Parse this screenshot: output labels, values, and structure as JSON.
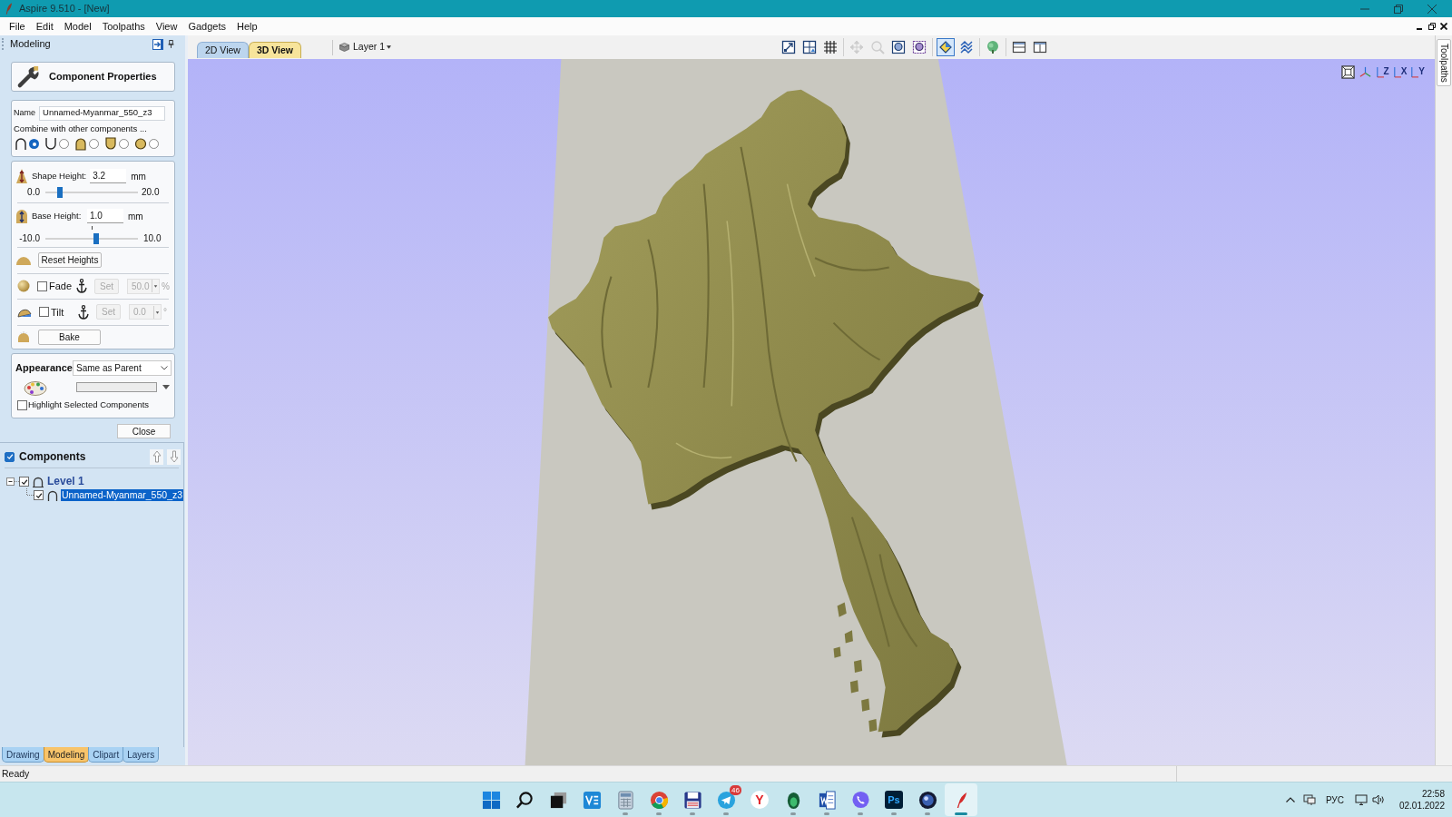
{
  "window": {
    "title": "Aspire 9.510 - [New]"
  },
  "menu": [
    "File",
    "Edit",
    "Model",
    "Toolpaths",
    "View",
    "Gadgets",
    "Help"
  ],
  "left_panel": {
    "title": "Modeling",
    "properties_header": "Component Properties",
    "name": {
      "label": "Name",
      "value": "Unnamed-Myanmar_550_z3"
    },
    "combine": {
      "label": "Combine with other components ...",
      "modes": [
        {
          "kind": "add",
          "selected": true
        },
        {
          "kind": "subtract",
          "selected": false
        },
        {
          "kind": "merge",
          "selected": false
        },
        {
          "kind": "low",
          "selected": false
        },
        {
          "kind": "multiply",
          "selected": false
        }
      ]
    },
    "shape_height": {
      "label": "Shape Height:",
      "value": "3.2",
      "unit": "mm",
      "min": "0.0",
      "max": "20.0",
      "level": 0.16
    },
    "base_height": {
      "label": "Base Height:",
      "value": "1.0",
      "unit": "mm",
      "min": "-10.0",
      "max": "10.0",
      "level": 0.55
    },
    "reset_button": "Reset Heights",
    "fade": {
      "label": "Fade",
      "checked": false,
      "disabled": true,
      "button": "Set",
      "value": "50.0",
      "unit": "%"
    },
    "tilt": {
      "label": "Tilt",
      "checked": false,
      "disabled": true,
      "button": "Set",
      "value": "0.0",
      "unit": "°"
    },
    "bake_button": "Bake",
    "appearance": {
      "label": "Appearance",
      "value": "Same as Parent"
    },
    "highlight": {
      "label": "Highlight Selected Components",
      "checked": false
    },
    "close_button": "Close",
    "components": {
      "title": "Components",
      "checked": true,
      "tree": [
        {
          "label": "Level 1",
          "checked": true,
          "expanded": true,
          "selected": false,
          "children": [
            {
              "label": "Unnamed-Myanmar_550_z3",
              "checked": true,
              "selected": true
            }
          ]
        }
      ]
    },
    "tabs": [
      {
        "label": "Drawing",
        "selected": false
      },
      {
        "label": "Modeling",
        "selected": true
      },
      {
        "label": "Clipart",
        "selected": false
      },
      {
        "label": "Layers",
        "selected": false
      }
    ]
  },
  "view": {
    "tabs": [
      {
        "label": "2D View",
        "selected": false
      },
      {
        "label": "3D View",
        "selected": true
      }
    ],
    "layer": "Layer 1",
    "toolbar": [
      [
        {
          "kind": "fit",
          "on": false,
          "disabled": false
        },
        {
          "kind": "split",
          "on": false,
          "disabled": false
        },
        {
          "kind": "grid",
          "on": false,
          "disabled": false
        }
      ],
      [
        {
          "kind": "pan",
          "on": false,
          "disabled": true
        },
        {
          "kind": "zoom",
          "on": false,
          "disabled": true
        },
        {
          "kind": "zoom-box",
          "on": false,
          "disabled": false
        },
        {
          "kind": "zoom-select",
          "on": false,
          "disabled": false
        }
      ],
      [
        {
          "kind": "shade",
          "on": true,
          "disabled": false
        },
        {
          "kind": "wave",
          "on": false,
          "disabled": false
        }
      ],
      [
        {
          "kind": "material",
          "on": false,
          "disabled": false
        }
      ],
      [
        {
          "kind": "tile-h",
          "on": false,
          "disabled": false
        },
        {
          "kind": "tile-v",
          "on": false,
          "disabled": false
        }
      ]
    ],
    "orientation_buttons": [
      {
        "kind": "fit"
      },
      {
        "kind": "iso"
      },
      {
        "kind": "axis",
        "label": "Z"
      },
      {
        "kind": "axis",
        "label": "X"
      },
      {
        "kind": "axis",
        "label": "Y"
      }
    ]
  },
  "side_tab": "Toolpaths",
  "status_bar": "Ready",
  "taskbar": {
    "apps": [
      {
        "kind": "start",
        "running": false,
        "selected": false
      },
      {
        "kind": "search",
        "running": false,
        "selected": false
      },
      {
        "kind": "taskview",
        "running": false,
        "selected": false
      },
      {
        "kind": "tile",
        "running": false,
        "selected": false
      },
      {
        "kind": "calculator",
        "running": true,
        "selected": false
      },
      {
        "kind": "browser",
        "running": true,
        "selected": false
      },
      {
        "kind": "floppy",
        "running": true,
        "selected": false
      },
      {
        "kind": "messenger",
        "running": true,
        "selected": false,
        "badge": "46"
      },
      {
        "kind": "letter",
        "label": "Y",
        "running": false,
        "selected": false
      },
      {
        "kind": "egg",
        "running": true,
        "selected": false
      },
      {
        "kind": "document",
        "running": true,
        "selected": false
      },
      {
        "kind": "phone",
        "running": true,
        "selected": false
      },
      {
        "kind": "letter-tile",
        "label": "Ps",
        "running": true,
        "selected": false
      },
      {
        "kind": "sphere",
        "running": true,
        "selected": false
      },
      {
        "kind": "feather",
        "running": true,
        "selected": true
      }
    ],
    "tray": {
      "language": "РУС",
      "time": "22:58",
      "date": "02.01.2022"
    }
  }
}
